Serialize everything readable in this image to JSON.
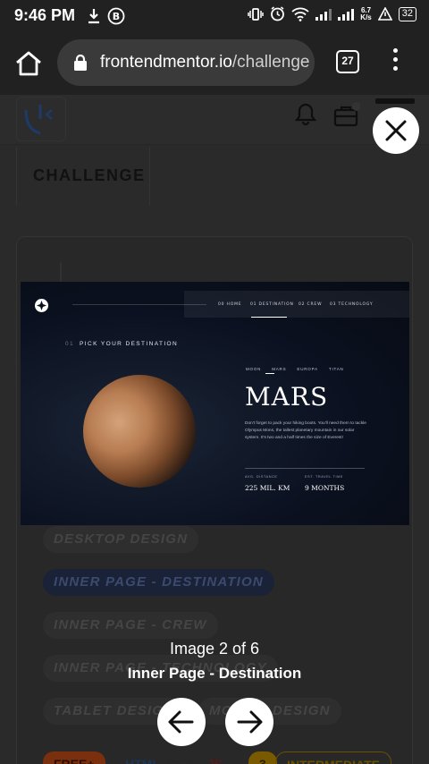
{
  "status": {
    "time": "9:46 PM",
    "speed_top": "6.7",
    "speed_unit": "K/s",
    "battery": "32"
  },
  "browser": {
    "url_domain": "frontendmentor.io",
    "url_path": "/challenge",
    "tab_count": "27"
  },
  "page": {
    "tab_label": "CHALLENGE",
    "tags": [
      "DESKTOP DESIGN",
      "INNER PAGE - DESTINATION",
      "INNER PAGE - CREW",
      "INNER PAGE - TECHNOLOGY",
      "TABLET DESIGN",
      "MOBILE DESIGN"
    ],
    "bottom_pills": [
      "FREE+",
      "HTML",
      "CSS",
      "JS",
      "3",
      "INTERMEDIATE"
    ]
  },
  "preview": {
    "nav": [
      "00 HOME",
      "01 DESTINATION",
      "02 CREW",
      "03 TECHNOLOGY"
    ],
    "pick_num": "01",
    "pick_label": "PICK YOUR DESTINATION",
    "moons": [
      "MOON",
      "MARS",
      "EUROPA",
      "TITAN"
    ],
    "planet_name": "MARS",
    "description": "Don't forget to pack your hiking boots. You'll need them to tackle Olympus Mons, the tallest planetary mountain in our solar system. It's two and a half times the size of Everest!",
    "stat1_label": "AVG. DISTANCE",
    "stat1_value": "225 MIL. KM",
    "stat2_label": "EST. TRAVEL TIME",
    "stat2_value": "9 MONTHS"
  },
  "lightbox": {
    "counter": "Image 2 of 6",
    "title": "Inner Page - Destination"
  }
}
